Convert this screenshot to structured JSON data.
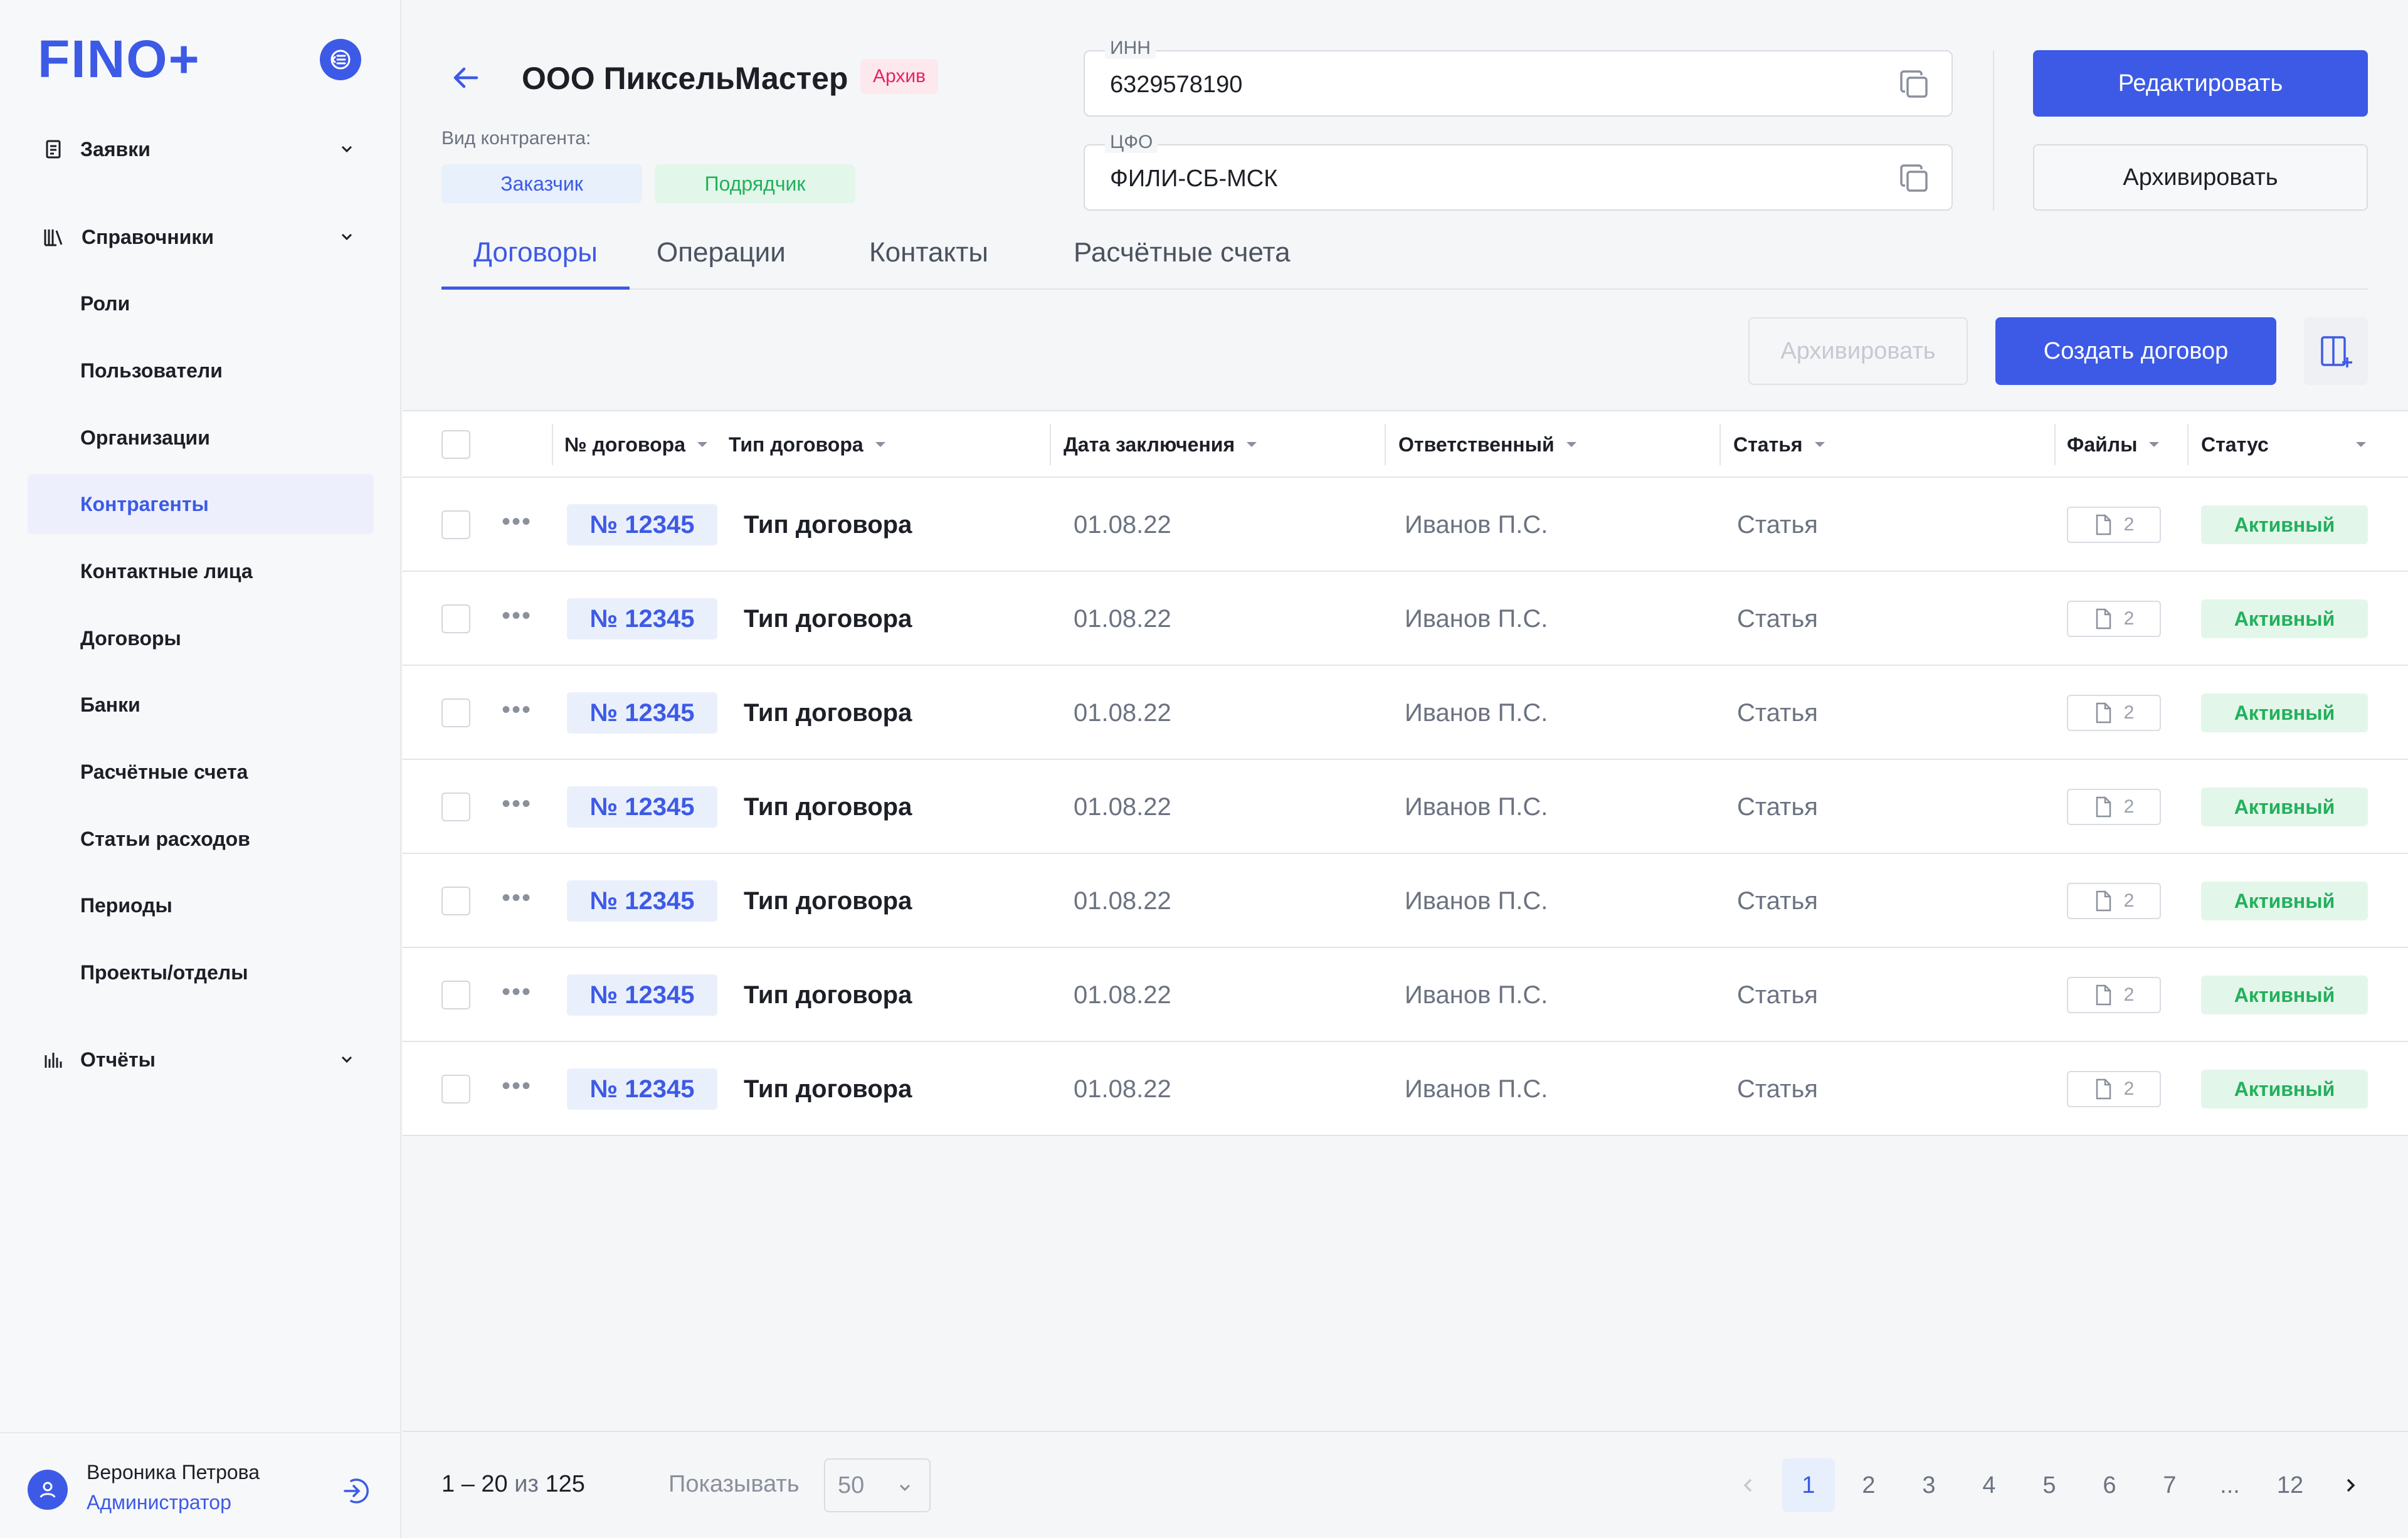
{
  "app": {
    "logo": "FINO+"
  },
  "sidebar": {
    "groups": [
      {
        "label": "Заявки",
        "icon": "document-icon"
      },
      {
        "label": "Справочники",
        "icon": "books-icon"
      },
      {
        "label": "Отчёты",
        "icon": "chart-icon"
      }
    ],
    "items": [
      {
        "label": "Роли"
      },
      {
        "label": "Пользователи"
      },
      {
        "label": "Организации"
      },
      {
        "label": "Контрагенты",
        "active": true
      },
      {
        "label": "Контактные лица"
      },
      {
        "label": "Договоры"
      },
      {
        "label": "Банки"
      },
      {
        "label": "Расчётные счета"
      },
      {
        "label": "Статьи расходов"
      },
      {
        "label": "Периоды"
      },
      {
        "label": "Проекты/отделы"
      }
    ],
    "user": {
      "name": "Вероника Петрова",
      "role": "Администратор"
    }
  },
  "header": {
    "title": "ООО ПиксельМастер",
    "badge": "Архив",
    "kind_label": "Вид контрагента:",
    "tags": [
      "Заказчик",
      "Подрядчик"
    ],
    "inn": {
      "label": "ИНН",
      "value": "6329578190"
    },
    "cfo": {
      "label": "ЦФО",
      "value": "ФИЛИ-СБ-МСК"
    },
    "edit_button": "Редактировать",
    "archive_button": "Архивировать"
  },
  "tabs": [
    {
      "label": "Договоры",
      "active": true
    },
    {
      "label": "Операции"
    },
    {
      "label": "Контакты"
    },
    {
      "label": "Расчётные счета"
    }
  ],
  "toolbar": {
    "archive_button": "Архивировать",
    "create_button": "Создать договор"
  },
  "table": {
    "columns": [
      "№ договора",
      "Тип договора",
      "Дата заключения",
      "Ответственный",
      "Статья",
      "Файлы",
      "Статус"
    ],
    "rows": [
      {
        "number": "№ 12345",
        "type": "Тип договора",
        "date": "01.08.22",
        "responsible": "Иванов П.С.",
        "article": "Статья",
        "files": "2",
        "status": "Активный"
      },
      {
        "number": "№ 12345",
        "type": "Тип договора",
        "date": "01.08.22",
        "responsible": "Иванов П.С.",
        "article": "Статья",
        "files": "2",
        "status": "Активный"
      },
      {
        "number": "№ 12345",
        "type": "Тип договора",
        "date": "01.08.22",
        "responsible": "Иванов П.С.",
        "article": "Статья",
        "files": "2",
        "status": "Активный"
      },
      {
        "number": "№ 12345",
        "type": "Тип договора",
        "date": "01.08.22",
        "responsible": "Иванов П.С.",
        "article": "Статья",
        "files": "2",
        "status": "Активный"
      },
      {
        "number": "№ 12345",
        "type": "Тип договора",
        "date": "01.08.22",
        "responsible": "Иванов П.С.",
        "article": "Статья",
        "files": "2",
        "status": "Активный"
      },
      {
        "number": "№ 12345",
        "type": "Тип договора",
        "date": "01.08.22",
        "responsible": "Иванов П.С.",
        "article": "Статья",
        "files": "2",
        "status": "Активный"
      },
      {
        "number": "№ 12345",
        "type": "Тип договора",
        "date": "01.08.22",
        "responsible": "Иванов П.С.",
        "article": "Статья",
        "files": "2",
        "status": "Активный"
      }
    ]
  },
  "footer": {
    "range": "1 – 20",
    "of": "из",
    "total": "125",
    "show_label": "Показывать",
    "per_page": "50",
    "pages": [
      "1",
      "2",
      "3",
      "4",
      "5",
      "6",
      "7",
      "...",
      "12"
    ],
    "current_page": "1"
  },
  "colors": {
    "accent": "#3d5ae6",
    "success": "#23b05c",
    "danger": "#e5245f"
  }
}
